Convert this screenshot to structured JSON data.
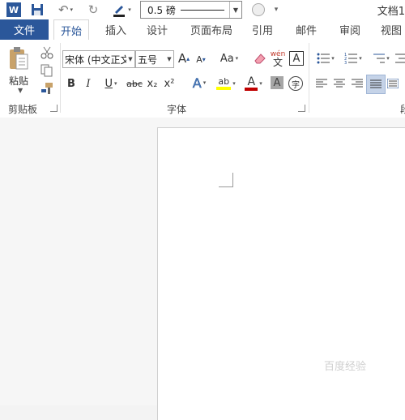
{
  "qat": {
    "word_logo": "W",
    "line_width": "0.5 磅",
    "doc_title": "文档1"
  },
  "tabs": {
    "file": "文件",
    "items": [
      "开始",
      "插入",
      "设计",
      "页面布局",
      "引用",
      "邮件",
      "审阅",
      "视图"
    ]
  },
  "clipboard": {
    "paste_label": "粘贴",
    "group_label": "剪贴板"
  },
  "font": {
    "font_name": "宋体 (中文正文",
    "font_size": "五号",
    "grow_label": "A",
    "shrink_label": "A",
    "case_label": "Aa",
    "phonetic_top": "wén",
    "phonetic_bottom": "文",
    "border_label": "A",
    "bold": "B",
    "italic": "I",
    "underline": "U",
    "strike": "abc",
    "sub": "x₂",
    "sup": "x²",
    "effects": "A",
    "highlight": "ab",
    "font_color": "A",
    "shade": "A",
    "circle": "字",
    "group_label": "字体"
  },
  "paragraph": {
    "group_label": "段"
  },
  "watermark": "百度经验",
  "colors": {
    "brand": "#2b579a",
    "highlight": "#ffff00",
    "font_color": "#c00000"
  }
}
